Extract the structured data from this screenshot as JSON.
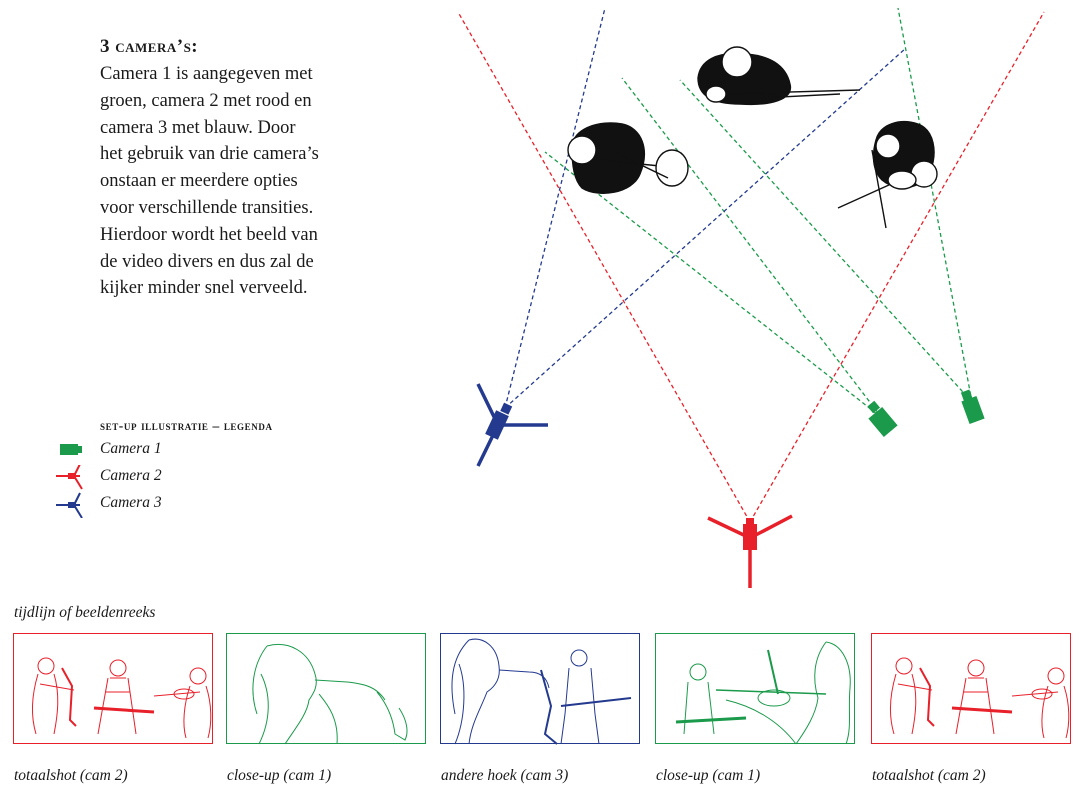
{
  "intro": {
    "heading": "3 camera’s:",
    "lines": [
      "Camera 1 is aangegeven met",
      "groen, camera 2 met rood en",
      "camera 3 met blauw. Door",
      "het gebruik van drie camera’s",
      "onstaan er meerdere opties",
      "voor verschillende transities.",
      "Hierdoor wordt het beeld van",
      "de video divers en dus zal de",
      "kijker minder snel verveeld."
    ]
  },
  "legend": {
    "title": "set-up illustratie – legenda",
    "items": [
      {
        "label": "Camera 1",
        "color": "#1a9a4a",
        "icon": "camera-icon"
      },
      {
        "label": "Camera 2",
        "color": "#e8202a",
        "icon": "tripod-camera-icon"
      },
      {
        "label": "Camera 3",
        "color": "#233a8f",
        "icon": "tripod-camera-icon"
      }
    ]
  },
  "timeline": {
    "title": "tijdlijn of beeldenreeks",
    "frames": [
      {
        "caption": "totaalshot (cam 2)",
        "color": "#e8202a",
        "scene": "totaalshot"
      },
      {
        "caption": "close-up (cam 1)",
        "color": "#1a9a4a",
        "scene": "close-up-saxophone"
      },
      {
        "caption": "andere hoek (cam 3)",
        "color": "#233a8f",
        "scene": "andere-hoek"
      },
      {
        "caption": "close-up (cam 1)",
        "color": "#1a9a4a",
        "scene": "close-up-violin"
      },
      {
        "caption": "totaalshot (cam 2)",
        "color": "#e8202a",
        "scene": "totaalshot"
      }
    ]
  },
  "colors": {
    "green": "#1a9a4a",
    "red": "#e8202a",
    "blue": "#233a8f",
    "ink": "#111111"
  }
}
